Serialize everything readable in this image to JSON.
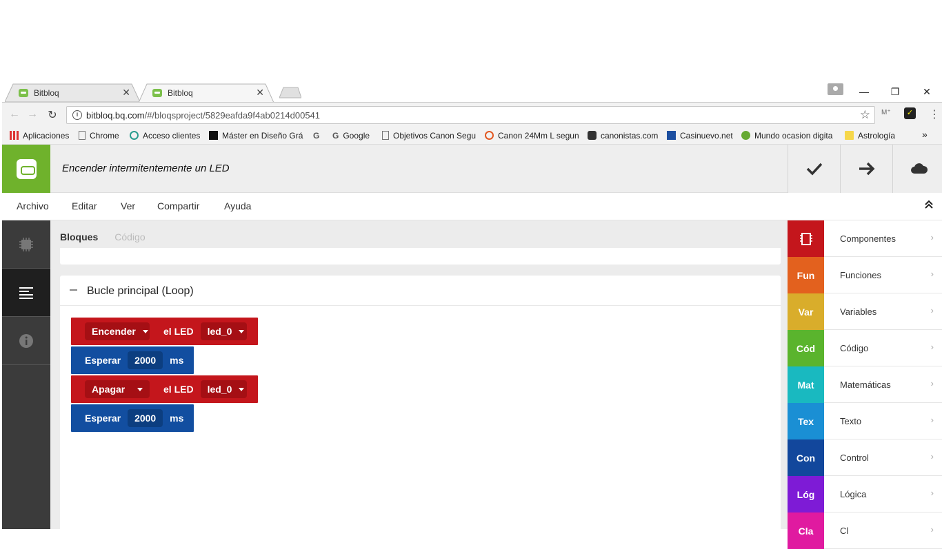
{
  "browser": {
    "tabs": [
      {
        "title": "Bitbloq",
        "active": false
      },
      {
        "title": "Bitbloq",
        "active": true
      }
    ],
    "url_host": "bitbloq.bq.com",
    "url_path": "/#/bloqsproject/5829eafda9f4ab0214d00541",
    "bookmarks": [
      "Aplicaciones",
      "Chrome",
      "Acceso clientes",
      "Máster en Diseño Grá",
      "Google",
      "Objetivos Canon Segu",
      "Canon 24Mm L segun",
      "canonistas.com",
      "Casinuevo.net",
      "Mundo ocasion digita",
      "Astrología"
    ],
    "bookmarks_more": "»"
  },
  "app": {
    "project_title": "Encender intermitentemente un LED",
    "menu": [
      "Archivo",
      "Editar",
      "Ver",
      "Compartir",
      "Ayuda"
    ],
    "workspace_tabs": {
      "active": "Bloques",
      "inactive": "Código"
    },
    "loop_title": "Bucle principal (Loop)",
    "blocks": [
      {
        "color": "#c4161c",
        "action": "Encender",
        "label": "el LED",
        "target": "led_0"
      },
      {
        "color": "#124ea0",
        "label": "Esperar",
        "value": "2000",
        "unit": "ms"
      },
      {
        "color": "#c4161c",
        "action": "Apagar",
        "label": "el LED",
        "target": "led_0"
      },
      {
        "color": "#124ea0",
        "label": "Esperar",
        "value": "2000",
        "unit": "ms"
      }
    ],
    "categories": [
      {
        "short": "",
        "name": "Componentes",
        "color": "#c4161c",
        "icon": "chip-icon"
      },
      {
        "short": "Fun",
        "name": "Funciones",
        "color": "#e3611e"
      },
      {
        "short": "Var",
        "name": "Variables",
        "color": "#d9ad2b"
      },
      {
        "short": "Cód",
        "name": "Código",
        "color": "#5ab42d"
      },
      {
        "short": "Mat",
        "name": "Matemáticas",
        "color": "#19b9c0"
      },
      {
        "short": "Tex",
        "name": "Texto",
        "color": "#1a8fd4"
      },
      {
        "short": "Con",
        "name": "Control",
        "color": "#12479c"
      },
      {
        "short": "Lóg",
        "name": "Lógica",
        "color": "#7e1bd6"
      },
      {
        "short": "Cla",
        "name": "Cl",
        "color": "#e01aa0"
      }
    ]
  }
}
